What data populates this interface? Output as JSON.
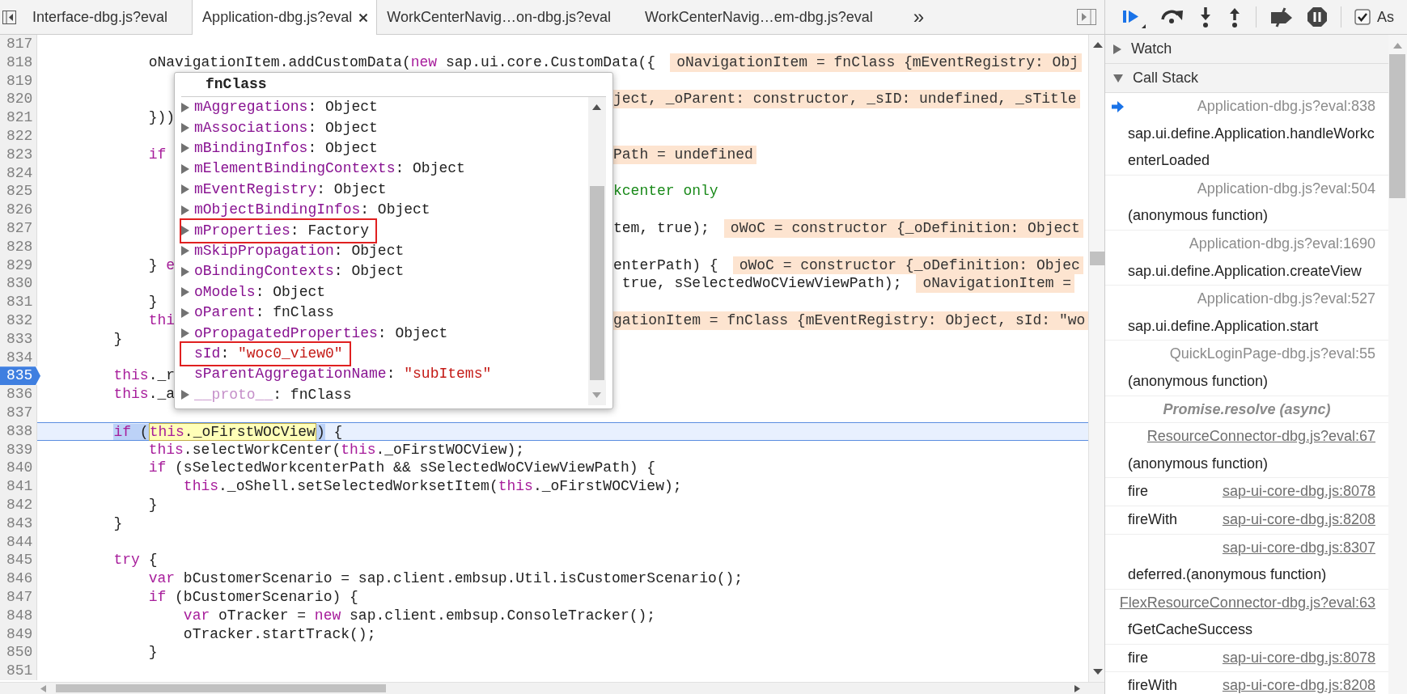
{
  "tabs": [
    {
      "label": "Interface-dbg.js?eval",
      "selected": false
    },
    {
      "label": "Application-dbg.js?eval",
      "selected": true
    },
    {
      "label": "WorkCenterNavig…on-dbg.js?eval",
      "selected": false
    },
    {
      "label": "WorkCenterNavig…em-dbg.js?eval",
      "selected": false
    }
  ],
  "tab_overflow": "»",
  "editor": {
    "lines": [
      {
        "number": "817",
        "breakpoint": false,
        "current": false
      },
      {
        "number": "818",
        "breakpoint": false,
        "current": false,
        "code": [
          {
            "kind": "plain",
            "text": "            oNavigationItem.addCustomData("
          },
          {
            "kind": "keyword",
            "text": "new"
          },
          {
            "kind": "plain",
            "text": " sap.ui.core.CustomData({"
          },
          {
            "kind": "value",
            "text": "oNavigationItem = fnClass {mEventRegistry: Obj"
          }
        ]
      },
      {
        "number": "819",
        "breakpoint": false,
        "current": false
      },
      {
        "number": "820",
        "breakpoint": false,
        "current": false,
        "right": [
          {
            "kind": "value",
            "text": "ject, _oParent: constructor, _sID: undefined, _sTitle"
          }
        ]
      },
      {
        "number": "821",
        "breakpoint": false,
        "current": false,
        "code": [
          {
            "kind": "plain",
            "text": "            }))"
          }
        ]
      },
      {
        "number": "822",
        "breakpoint": false,
        "current": false
      },
      {
        "number": "823",
        "breakpoint": false,
        "current": false,
        "code": [
          {
            "kind": "keyword",
            "text": "            if"
          }
        ],
        "right": [
          {
            "kind": "value",
            "text": "Path = undefined"
          }
        ]
      },
      {
        "number": "824",
        "breakpoint": false,
        "current": false
      },
      {
        "number": "825",
        "breakpoint": false,
        "current": false,
        "right": [
          {
            "kind": "comment",
            "text": "kcenter only"
          }
        ]
      },
      {
        "number": "826",
        "breakpoint": false,
        "current": false
      },
      {
        "number": "827",
        "breakpoint": false,
        "current": false,
        "right": [
          {
            "kind": "plain",
            "text": "tem, true);"
          },
          {
            "kind": "value",
            "text": "oWoC = constructor {_oDefinition: Object"
          }
        ]
      },
      {
        "number": "828",
        "breakpoint": false,
        "current": false
      },
      {
        "number": "829",
        "breakpoint": false,
        "current": false,
        "code": [
          {
            "kind": "plain",
            "text": "            } "
          },
          {
            "kind": "keyword",
            "text": "e"
          }
        ],
        "right": [
          {
            "kind": "plain",
            "text": "enterPath) {"
          },
          {
            "kind": "value",
            "text": "oWoC = constructor {_oDefinition: Objec"
          }
        ]
      },
      {
        "number": "830",
        "breakpoint": false,
        "current": false,
        "right": [
          {
            "kind": "plain",
            "text": " true, sSelectedWoCViewViewPath);"
          },
          {
            "kind": "value",
            "text": "oNavigationItem ="
          }
        ]
      },
      {
        "number": "831",
        "breakpoint": false,
        "current": false,
        "code": [
          {
            "kind": "plain",
            "text": "            }"
          }
        ]
      },
      {
        "number": "832",
        "breakpoint": false,
        "current": false,
        "code": [
          {
            "kind": "keyword",
            "text": "            thi"
          }
        ],
        "right": [
          {
            "kind": "value",
            "text": "gationItem = fnClass {mEventRegistry: Object, sId: \"wo"
          }
        ]
      },
      {
        "number": "833",
        "breakpoint": false,
        "current": false,
        "code": [
          {
            "kind": "plain",
            "text": "        }"
          }
        ]
      },
      {
        "number": "834",
        "breakpoint": false,
        "current": false
      },
      {
        "number": "835",
        "breakpoint": true,
        "current": false,
        "code": [
          {
            "kind": "keyword",
            "text": "        this"
          },
          {
            "kind": "plain",
            "text": "._r"
          }
        ]
      },
      {
        "number": "836",
        "breakpoint": false,
        "current": false,
        "code": [
          {
            "kind": "keyword",
            "text": "        this"
          },
          {
            "kind": "plain",
            "text": "._a"
          }
        ]
      },
      {
        "number": "837",
        "breakpoint": false,
        "current": false
      },
      {
        "number": "838",
        "breakpoint": false,
        "current": true,
        "code": [
          {
            "kind": "keyword",
            "text": "        if",
            "in_selection": true,
            "hovered": false
          },
          {
            "kind": "plain",
            "text": " (",
            "in_selection": true,
            "hovered": false
          },
          {
            "kind": "keyword",
            "text": "this",
            "in_selection": false,
            "hovered": true
          },
          {
            "kind": "plain",
            "text": "._oFirstWOCView",
            "in_selection": false,
            "hovered": true
          },
          {
            "kind": "plain",
            "text": ")",
            "in_selection": true,
            "hovered": false
          },
          {
            "kind": "plain",
            "text": " {",
            "in_selection": false,
            "hovered": false
          }
        ]
      },
      {
        "number": "839",
        "breakpoint": false,
        "current": false,
        "code": [
          {
            "kind": "keyword",
            "text": "            this"
          },
          {
            "kind": "plain",
            "text": ".selectWorkCenter("
          },
          {
            "kind": "keyword",
            "text": "this"
          },
          {
            "kind": "plain",
            "text": "._oFirstWOCView);"
          }
        ]
      },
      {
        "number": "840",
        "breakpoint": false,
        "current": false,
        "code": [
          {
            "kind": "keyword",
            "text": "            if"
          },
          {
            "kind": "plain",
            "text": " (sSelectedWorkcenterPath && sSelectedWoCViewViewPath) {"
          }
        ]
      },
      {
        "number": "841",
        "breakpoint": false,
        "current": false,
        "code": [
          {
            "kind": "keyword",
            "text": "                this"
          },
          {
            "kind": "plain",
            "text": "._oShell.setSelectedWorksetItem("
          },
          {
            "kind": "keyword",
            "text": "this"
          },
          {
            "kind": "plain",
            "text": "._oFirstWOCView);"
          }
        ]
      },
      {
        "number": "842",
        "breakpoint": false,
        "current": false,
        "code": [
          {
            "kind": "plain",
            "text": "            }"
          }
        ]
      },
      {
        "number": "843",
        "breakpoint": false,
        "current": false,
        "code": [
          {
            "kind": "plain",
            "text": "        }"
          }
        ]
      },
      {
        "number": "844",
        "breakpoint": false,
        "current": false
      },
      {
        "number": "845",
        "breakpoint": false,
        "current": false,
        "code": [
          {
            "kind": "keyword",
            "text": "        try"
          },
          {
            "kind": "plain",
            "text": " {"
          }
        ]
      },
      {
        "number": "846",
        "breakpoint": false,
        "current": false,
        "code": [
          {
            "kind": "keyword",
            "text": "            var"
          },
          {
            "kind": "plain",
            "text": " bCustomerScenario = sap.client.embsup.Util.isCustomerScenario();"
          }
        ]
      },
      {
        "number": "847",
        "breakpoint": false,
        "current": false,
        "code": [
          {
            "kind": "keyword",
            "text": "            if"
          },
          {
            "kind": "plain",
            "text": " (bCustomerScenario) {"
          }
        ]
      },
      {
        "number": "848",
        "breakpoint": false,
        "current": false,
        "code": [
          {
            "kind": "keyword",
            "text": "                var"
          },
          {
            "kind": "plain",
            "text": " oTracker = "
          },
          {
            "kind": "keyword",
            "text": "new"
          },
          {
            "kind": "plain",
            "text": " sap.client.embsup.ConsoleTracker();"
          }
        ]
      },
      {
        "number": "849",
        "breakpoint": false,
        "current": false,
        "code": [
          {
            "kind": "plain",
            "text": "                oTracker.startTrack();"
          }
        ]
      },
      {
        "number": "850",
        "breakpoint": false,
        "current": false,
        "code": [
          {
            "kind": "plain",
            "text": "            }"
          }
        ]
      },
      {
        "number": "851",
        "breakpoint": false,
        "current": false
      }
    ]
  },
  "popup": {
    "title": "fnClass",
    "separator": ":",
    "properties": [
      {
        "name": "mAggregations",
        "value": "Object",
        "is_string": false,
        "expandable": true,
        "outlined": false,
        "dimmed": false
      },
      {
        "name": "mAssociations",
        "value": "Object",
        "is_string": false,
        "expandable": true,
        "outlined": false,
        "dimmed": false
      },
      {
        "name": "mBindingInfos",
        "value": "Object",
        "is_string": false,
        "expandable": true,
        "outlined": false,
        "dimmed": false
      },
      {
        "name": "mElementBindingContexts",
        "value": "Object",
        "is_string": false,
        "expandable": true,
        "outlined": false,
        "dimmed": false
      },
      {
        "name": "mEventRegistry",
        "value": "Object",
        "is_string": false,
        "expandable": true,
        "outlined": false,
        "dimmed": false
      },
      {
        "name": "mObjectBindingInfos",
        "value": "Object",
        "is_string": false,
        "expandable": true,
        "outlined": false,
        "dimmed": false
      },
      {
        "name": "mProperties",
        "value": "Factory",
        "is_string": false,
        "expandable": true,
        "outlined": true,
        "dimmed": false
      },
      {
        "name": "mSkipPropagation",
        "value": "Object",
        "is_string": false,
        "expandable": true,
        "outlined": false,
        "dimmed": false
      },
      {
        "name": "oBindingContexts",
        "value": "Object",
        "is_string": false,
        "expandable": true,
        "outlined": false,
        "dimmed": false
      },
      {
        "name": "oModels",
        "value": "Object",
        "is_string": false,
        "expandable": true,
        "outlined": false,
        "dimmed": false
      },
      {
        "name": "oParent",
        "value": "fnClass",
        "is_string": false,
        "expandable": true,
        "outlined": false,
        "dimmed": false
      },
      {
        "name": "oPropagatedProperties",
        "value": "Object",
        "is_string": false,
        "expandable": true,
        "outlined": false,
        "dimmed": false
      },
      {
        "name": "sId",
        "value": "\"woc0_view0\"",
        "is_string": true,
        "expandable": false,
        "outlined": true,
        "dimmed": false
      },
      {
        "name": "sParentAggregationName",
        "value": "\"subItems\"",
        "is_string": true,
        "expandable": false,
        "outlined": false,
        "dimmed": false
      },
      {
        "name": "__proto__",
        "value": "fnClass",
        "is_string": false,
        "expandable": true,
        "outlined": false,
        "dimmed": true
      }
    ]
  },
  "debugger": {
    "async": {
      "label": "As",
      "checked": true
    },
    "sections": [
      {
        "title": "Watch",
        "expanded": false
      },
      {
        "title": "Call Stack",
        "expanded": true
      }
    ],
    "call_stack": [
      {
        "kind": "frame",
        "function": "sap.ui.define.Application.handleWorkcenterLoaded",
        "location": "Application-dbg.js?eval:838",
        "current": true,
        "underlined": false
      },
      {
        "kind": "frame",
        "function": "(anonymous function)",
        "location": "Application-dbg.js?eval:504",
        "current": false,
        "underlined": false
      },
      {
        "kind": "frame",
        "function": "sap.ui.define.Application.createView",
        "location": "Application-dbg.js?eval:1690",
        "current": false,
        "underlined": false
      },
      {
        "kind": "frame",
        "function": "sap.ui.define.Application.start",
        "location": "Application-dbg.js?eval:527",
        "current": false,
        "underlined": false
      },
      {
        "kind": "frame",
        "function": "(anonymous function)",
        "location": "QuickLoginPage-dbg.js?eval:55",
        "current": false,
        "underlined": false
      },
      {
        "kind": "async",
        "label": "Promise.resolve (async)"
      },
      {
        "kind": "frame",
        "function": "(anonymous function)",
        "location": "ResourceConnector-dbg.js?eval:67",
        "current": false,
        "underlined": true
      },
      {
        "kind": "frame",
        "function": "fire",
        "location": "sap-ui-core-dbg.js:8078",
        "current": false,
        "underlined": true
      },
      {
        "kind": "frame",
        "function": "fireWith",
        "location": "sap-ui-core-dbg.js:8208",
        "current": false,
        "underlined": true
      },
      {
        "kind": "frame",
        "function": "deferred.(anonymous function)",
        "location": "sap-ui-core-dbg.js:8307",
        "current": false,
        "underlined": true
      },
      {
        "kind": "frame",
        "function": "fGetCacheSuccess",
        "location": "FlexResourceConnector-dbg.js?eval:63",
        "current": false,
        "underlined": true
      },
      {
        "kind": "frame",
        "function": "fire",
        "location": "sap-ui-core-dbg.js:8078",
        "current": false,
        "underlined": true
      },
      {
        "kind": "frame",
        "function": "fireWith",
        "location": "sap-ui-core-dbg.js:8208",
        "current": false,
        "underlined": true
      }
    ]
  }
}
